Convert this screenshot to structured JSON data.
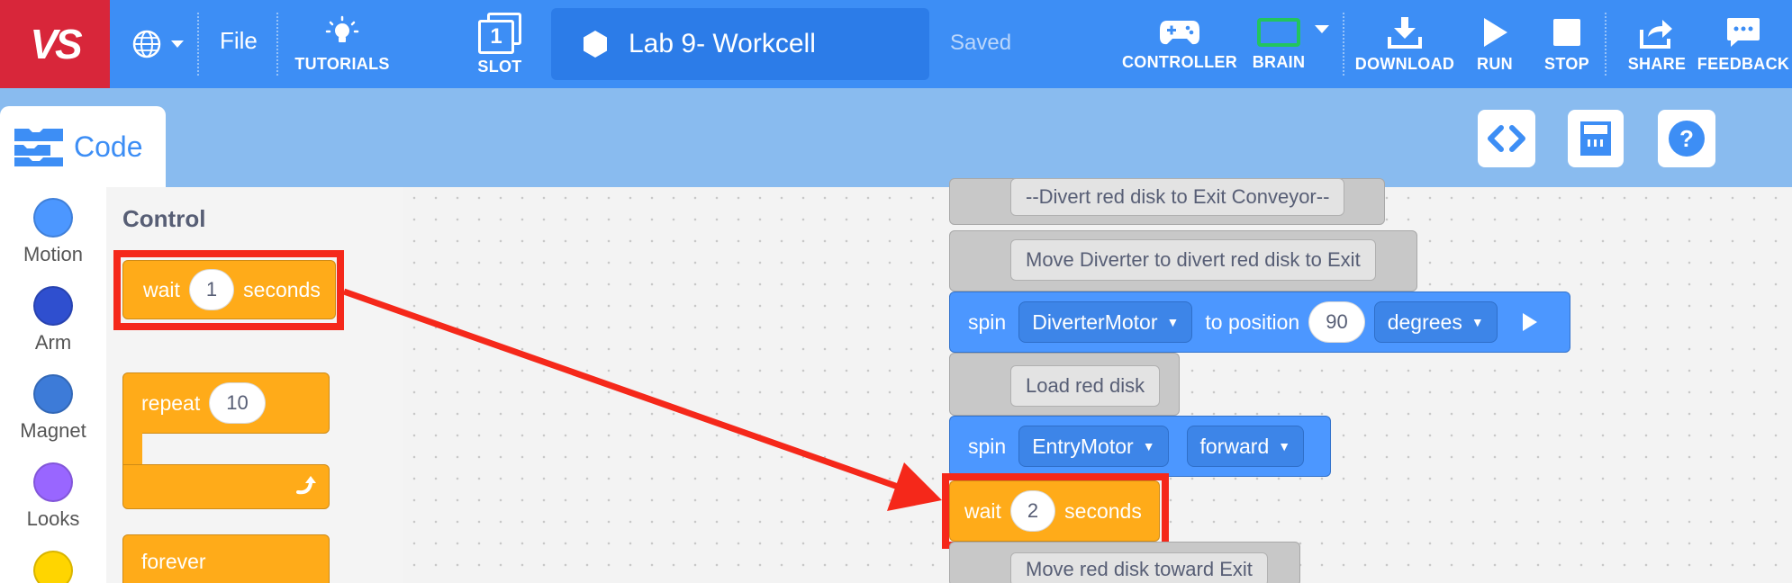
{
  "header": {
    "logo": "VS",
    "file_label": "File",
    "tutorials_label": "TUTORIALS",
    "slot_label": "SLOT",
    "slot_number": "1",
    "project_name": "Lab 9- Workcell",
    "saved_status": "Saved",
    "controller_label": "CONTROLLER",
    "brain_label": "BRAIN",
    "download_label": "DOWNLOAD",
    "run_label": "RUN",
    "stop_label": "STOP",
    "share_label": "SHARE",
    "feedback_label": "FEEDBACK"
  },
  "code_tab": {
    "label": "Code"
  },
  "categories": [
    {
      "label": "Motion",
      "color": "#4c97ff"
    },
    {
      "label": "Arm",
      "color": "#2f4fcf"
    },
    {
      "label": "Magnet",
      "color": "#3d7bd8"
    },
    {
      "label": "Looks",
      "color": "#9966ff"
    },
    {
      "label": "",
      "color": "#ffd500"
    }
  ],
  "palette": {
    "section_title": "Control",
    "wait_block": {
      "text1": "wait",
      "value": "1",
      "text2": "seconds"
    },
    "repeat_block": {
      "text": "repeat",
      "value": "10"
    },
    "forever_block": {
      "text": "forever"
    }
  },
  "workspace": {
    "comment1": "--Divert red disk to Exit Conveyor--",
    "comment2": "Move Diverter to divert red disk to Exit",
    "spin1": {
      "text1": "spin",
      "motor": "DiverterMotor",
      "text2": "to position",
      "value": "90",
      "unit": "degrees"
    },
    "comment3": "Load red disk",
    "spin2": {
      "text1": "spin",
      "motor": "EntryMotor",
      "direction": "forward"
    },
    "wait": {
      "text1": "wait",
      "value": "2",
      "text2": "seconds"
    },
    "comment4": "Move red disk toward Exit"
  },
  "colors": {
    "topbar": "#3d8ef5",
    "logo_bg": "#d8263a",
    "control_orange": "#ffab19",
    "motion_blue": "#4c97ff",
    "comment_gray": "#c8c8c8",
    "highlight_red": "#f5281a",
    "brain_green": "#22c55e"
  }
}
